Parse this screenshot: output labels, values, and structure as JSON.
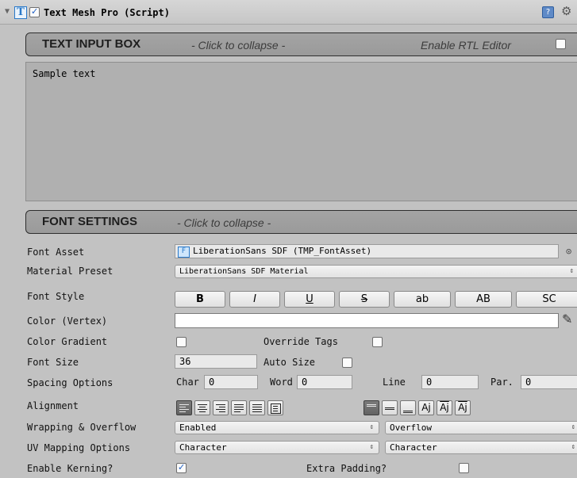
{
  "header": {
    "title": "Text Mesh Pro (Script)",
    "enabled": true
  },
  "text_input": {
    "section_title": "TEXT INPUT BOX",
    "collapse_hint": "- Click to collapse -",
    "rtl_label": "Enable RTL Editor",
    "rtl_enabled": false,
    "text": "Sample text"
  },
  "font_settings": {
    "section_title": "FONT SETTINGS",
    "collapse_hint": "- Click to collapse -",
    "font_asset": {
      "label": "Font Asset",
      "value": "LiberationSans SDF (TMP_FontAsset)"
    },
    "material_preset": {
      "label": "Material Preset",
      "value": "LiberationSans SDF Material"
    },
    "font_style": {
      "label": "Font Style",
      "buttons": [
        "B",
        "I",
        "U",
        "S",
        "ab",
        "AB",
        "SC"
      ]
    },
    "color_vertex": {
      "label": "Color (Vertex)",
      "color": "#ffffff"
    },
    "color_gradient": {
      "label": "Color Gradient",
      "override_label": "Override Tags"
    },
    "font_size": {
      "label": "Font Size",
      "value": "36",
      "auto_size_label": "Auto Size"
    },
    "spacing": {
      "label": "Spacing Options",
      "char_label": "Char",
      "char_value": "0",
      "word_label": "Word",
      "word_value": "0",
      "line_label": "Line",
      "line_value": "0",
      "par_label": "Par.",
      "par_value": "0"
    },
    "alignment": {
      "label": "Alignment"
    },
    "wrapping": {
      "label": "Wrapping & Overflow",
      "wrap_value": "Enabled",
      "overflow_value": "Overflow"
    },
    "uv_mapping": {
      "label": "UV Mapping Options",
      "horizontal": "Character",
      "vertical": "Character"
    },
    "kerning": {
      "label": "Enable Kerning?",
      "enabled": true,
      "extra_padding_label": "Extra Padding?",
      "extra_padding": false
    }
  }
}
